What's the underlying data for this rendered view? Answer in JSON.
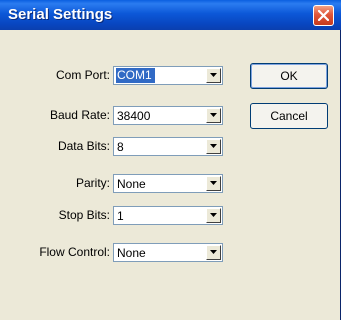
{
  "window": {
    "title": "Serial Settings"
  },
  "fields": [
    {
      "label": "Com Port:",
      "value": "COM1"
    },
    {
      "label": "Baud Rate:",
      "value": "38400"
    },
    {
      "label": "Data Bits:",
      "value": "8"
    },
    {
      "label": "Parity:",
      "value": "None"
    },
    {
      "label": "Stop Bits:",
      "value": "1"
    },
    {
      "label": "Flow Control:",
      "value": "None"
    }
  ],
  "buttons": {
    "ok": "OK",
    "cancel": "Cancel"
  },
  "icons": {
    "close": "close-icon",
    "dropdown": "chevron-down-icon"
  },
  "colors": {
    "titlebar": "#0a5fe0",
    "dialog_bg": "#ece9d8",
    "selection": "#316ac5",
    "close_button": "#e0563a"
  }
}
